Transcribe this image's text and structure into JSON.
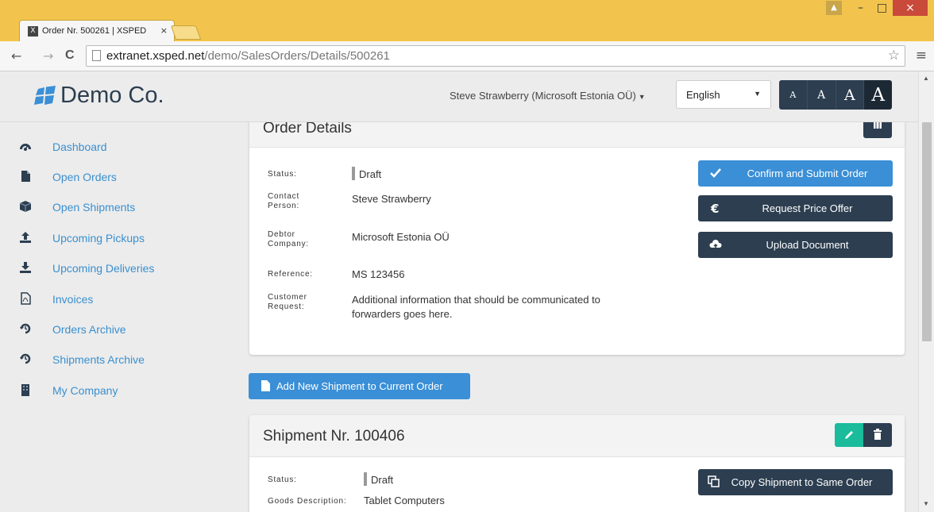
{
  "browser": {
    "tab_title": "Order Nr. 500261 | XSPED",
    "tab_close": "×",
    "favicon": "X",
    "url_host": "extranet.xsped.net",
    "url_path": "/demo/SalesOrders/Details/500261",
    "back": "←",
    "forward": "→",
    "reload": "C",
    "star": "☆",
    "menu": "≡",
    "minimize": "–",
    "maximize": "□",
    "close": "×",
    "user": "▲"
  },
  "header": {
    "brand": "Demo Co.",
    "user": "Steve Strawberry (Microsoft Estonia OÜ)",
    "language": "English",
    "font_sizes": [
      "A",
      "A",
      "A",
      "A"
    ]
  },
  "sidebar": {
    "items": [
      {
        "label": "Dashboard",
        "icon": "dashboard-icon"
      },
      {
        "label": "Open Orders",
        "icon": "file-icon"
      },
      {
        "label": "Open Shipments",
        "icon": "box-icon"
      },
      {
        "label": "Upcoming Pickups",
        "icon": "upload-icon"
      },
      {
        "label": "Upcoming Deliveries",
        "icon": "download-icon"
      },
      {
        "label": "Invoices",
        "icon": "pdf-icon"
      },
      {
        "label": "Orders Archive",
        "icon": "history-icon"
      },
      {
        "label": "Shipments Archive",
        "icon": "history-icon"
      },
      {
        "label": "My Company",
        "icon": "building-icon"
      }
    ]
  },
  "order": {
    "title": "Order Details",
    "fields": [
      {
        "label": "Status:",
        "value": "Draft"
      },
      {
        "label": "Contact Person:",
        "value": "Steve Strawberry"
      },
      {
        "label": "Debtor Company:",
        "value": "Microsoft Estonia OÜ"
      },
      {
        "label": "Reference:",
        "value": "MS 123456"
      },
      {
        "label": "Customer Request:",
        "value": "Additional information that should be communicated to forwarders goes here."
      }
    ],
    "actions": {
      "confirm": "Confirm and Submit Order",
      "price_offer": "Request Price Offer",
      "upload": "Upload Document"
    },
    "add_shipment": "Add New Shipment to Current Order"
  },
  "shipment": {
    "title": "Shipment Nr. 100406",
    "fields": [
      {
        "label": "Status:",
        "value": "Draft"
      },
      {
        "label": "Goods Description:",
        "value": "Tablet Computers"
      }
    ],
    "copy_button": "Copy Shipment to Same Order"
  },
  "colors": {
    "primary": "#3a8fd6",
    "dark": "#2c3e50",
    "success": "#1abc9c",
    "link": "#3a8fcf"
  }
}
